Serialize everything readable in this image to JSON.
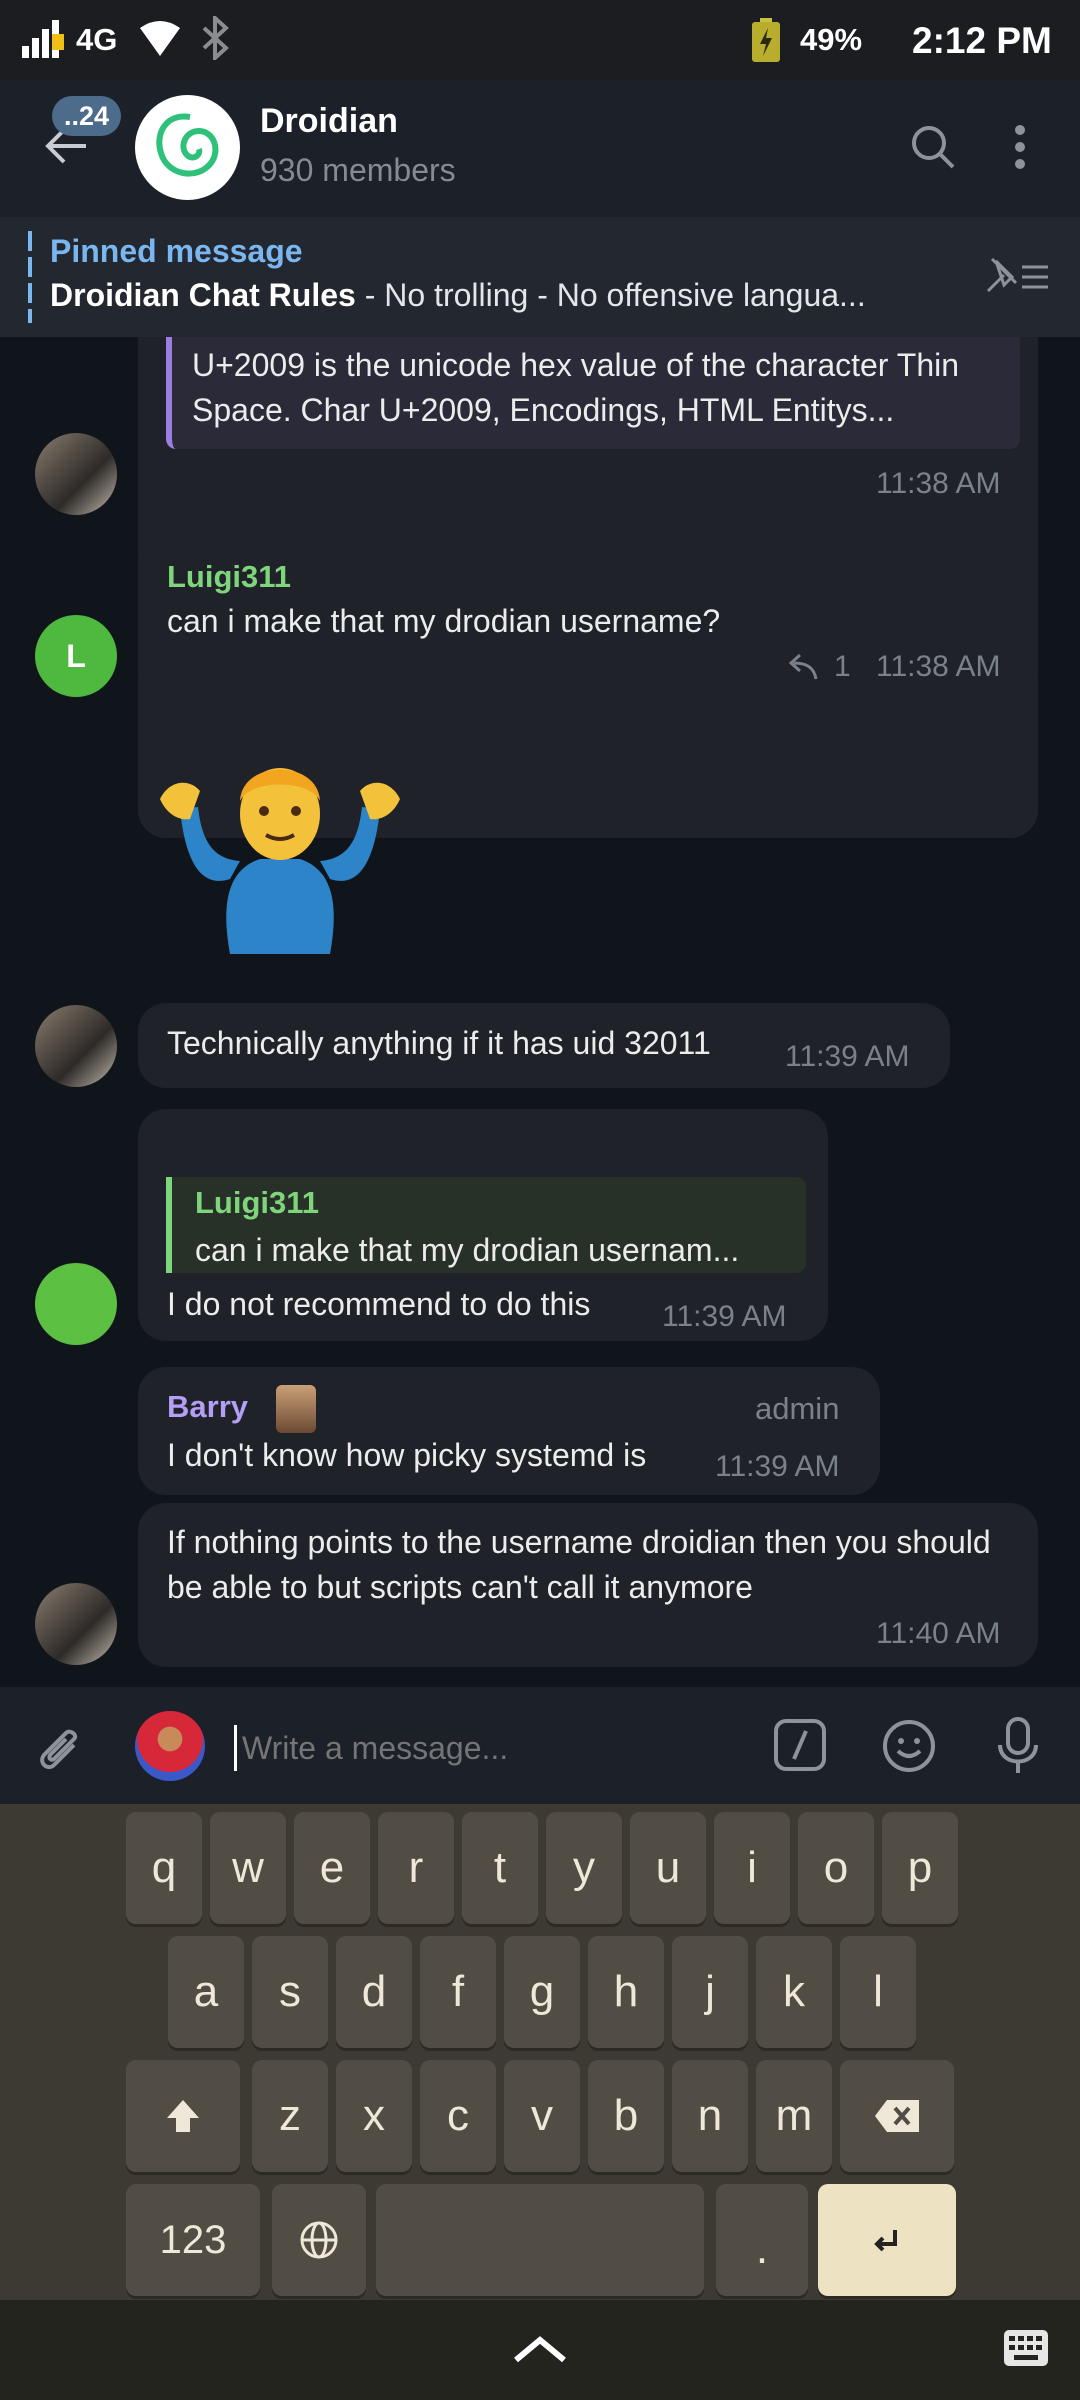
{
  "status_bar": {
    "network": "4G",
    "battery": "49%",
    "time": "2:12 PM"
  },
  "header": {
    "back_badge": "..24",
    "title": "Droidian",
    "subtitle": "930 members"
  },
  "pinned": {
    "label": "Pinned message",
    "title": "Droidian Chat Rules",
    "preview": " - No trolling - No offensive langua..."
  },
  "messages": {
    "m1": {
      "quote_text": "U+2009 is the unicode hex value of the character Thin Space. Char U+2009, Encodings, HTML Entitys...",
      "time": "11:38 AM"
    },
    "m2": {
      "avatar_letter": "L",
      "author": "Luigi311",
      "text": "can i make that my drodian username?",
      "reply_count": "1",
      "time": "11:38 AM"
    },
    "m3": {
      "text": "Technically anything if it has uid 32011",
      "time": "11:39 AM"
    },
    "m4": {
      "quote_author": "Luigi311",
      "quote_text": "can i make that my drodian usernam...",
      "text": "I do not recommend to do this",
      "time": "11:39 AM"
    },
    "m5": {
      "author": "Barry",
      "badge": "admin",
      "text": "I don't know how picky systemd is",
      "time": "11:39 AM"
    },
    "m6": {
      "text": "If nothing points to the username droidian then you should be able to but scripts can't call it anymore",
      "time": "11:40 AM"
    }
  },
  "composer": {
    "placeholder": "Write a message..."
  },
  "keyboard": {
    "row1": [
      "q",
      "w",
      "e",
      "r",
      "t",
      "y",
      "u",
      "i",
      "o",
      "p"
    ],
    "row2": [
      "a",
      "s",
      "d",
      "f",
      "g",
      "h",
      "j",
      "k",
      "l"
    ],
    "row3": [
      "z",
      "x",
      "c",
      "v",
      "b",
      "n",
      "m"
    ],
    "numbers_key": "123",
    "period_key": "."
  },
  "colors": {
    "background": "#10141b",
    "bubble": "#1f2229",
    "green_name": "#7fd57b",
    "purple_name": "#b59ef6",
    "quote_purple": "#9b7fe0",
    "pinned_blue": "#7ab6f0",
    "enter_key": "#ede3c3"
  },
  "icons": [
    "signal-icon",
    "wifi-icon",
    "bluetooth-icon",
    "battery-icon",
    "back-arrow-icon",
    "search-icon",
    "more-vert-icon",
    "unpin-list-icon",
    "reply-icon",
    "attach-icon",
    "command-icon",
    "emoji-icon",
    "mic-icon",
    "shift-icon",
    "backspace-icon",
    "globe-icon",
    "enter-icon",
    "nav-up-icon",
    "keyboard-icon"
  ]
}
